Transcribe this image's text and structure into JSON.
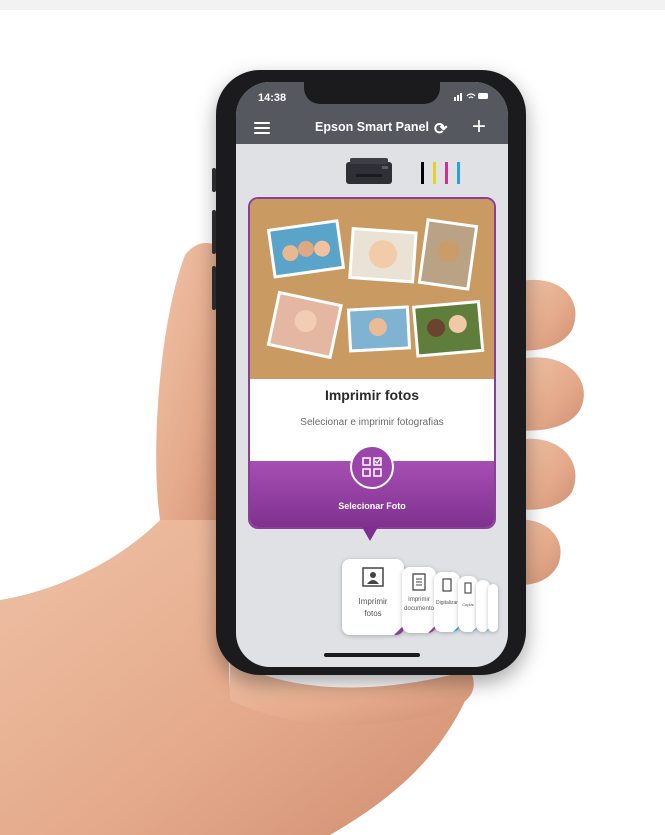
{
  "status_bar": {
    "time": "14:38",
    "icons": "📶 ᯤ ▭"
  },
  "app_bar": {
    "title": "Epson Smart Panel"
  },
  "ink_colors": [
    "#000000",
    "#e8d21f",
    "#d0308f",
    "#2aa0dc"
  ],
  "card": {
    "title": "Imprimir fotos",
    "subtitle": "Selecionar e imprimir fotografias",
    "action_label": "Selecionar Foto"
  },
  "tiles": [
    {
      "label_line1": "Imprimir",
      "label_line2": "fotos"
    },
    {
      "label_line1": "Imprimir",
      "label_line2": "documento"
    },
    {
      "label_line1": "Digitalizar",
      "label_line2": ""
    },
    {
      "label_line1": "Copiar",
      "label_line2": ""
    }
  ]
}
